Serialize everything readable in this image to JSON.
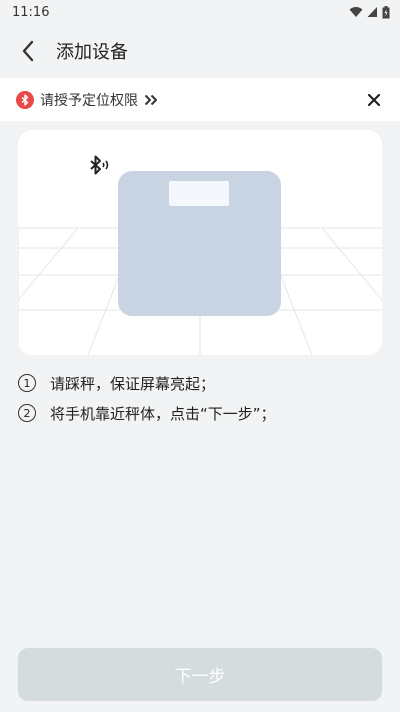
{
  "status_bar": {
    "time": "11:16",
    "icons": [
      "wifi-icon",
      "cellular-icon",
      "battery-icon"
    ]
  },
  "header": {
    "title": "添加设备",
    "back_icon": "chevron-left-icon"
  },
  "permission_banner": {
    "text": "请授予定位权限",
    "icon": "bluetooth-icon",
    "accent": "#e84a4a",
    "arrow_icon": "double-chevron-right-icon",
    "close_icon": "close-icon"
  },
  "illustration": {
    "icons": [
      "bluetooth-signal-icon",
      "scale-icon"
    ],
    "scale_color": "#c9d4e2"
  },
  "steps": [
    {
      "num": "1",
      "text": "请踩秤，保证屏幕亮起；"
    },
    {
      "num": "2",
      "text": "将手机靠近秤体，点击“下一步”；"
    }
  ],
  "footer": {
    "next_label": "下一步",
    "disabled": true,
    "button_color": "#d5dcdd"
  }
}
